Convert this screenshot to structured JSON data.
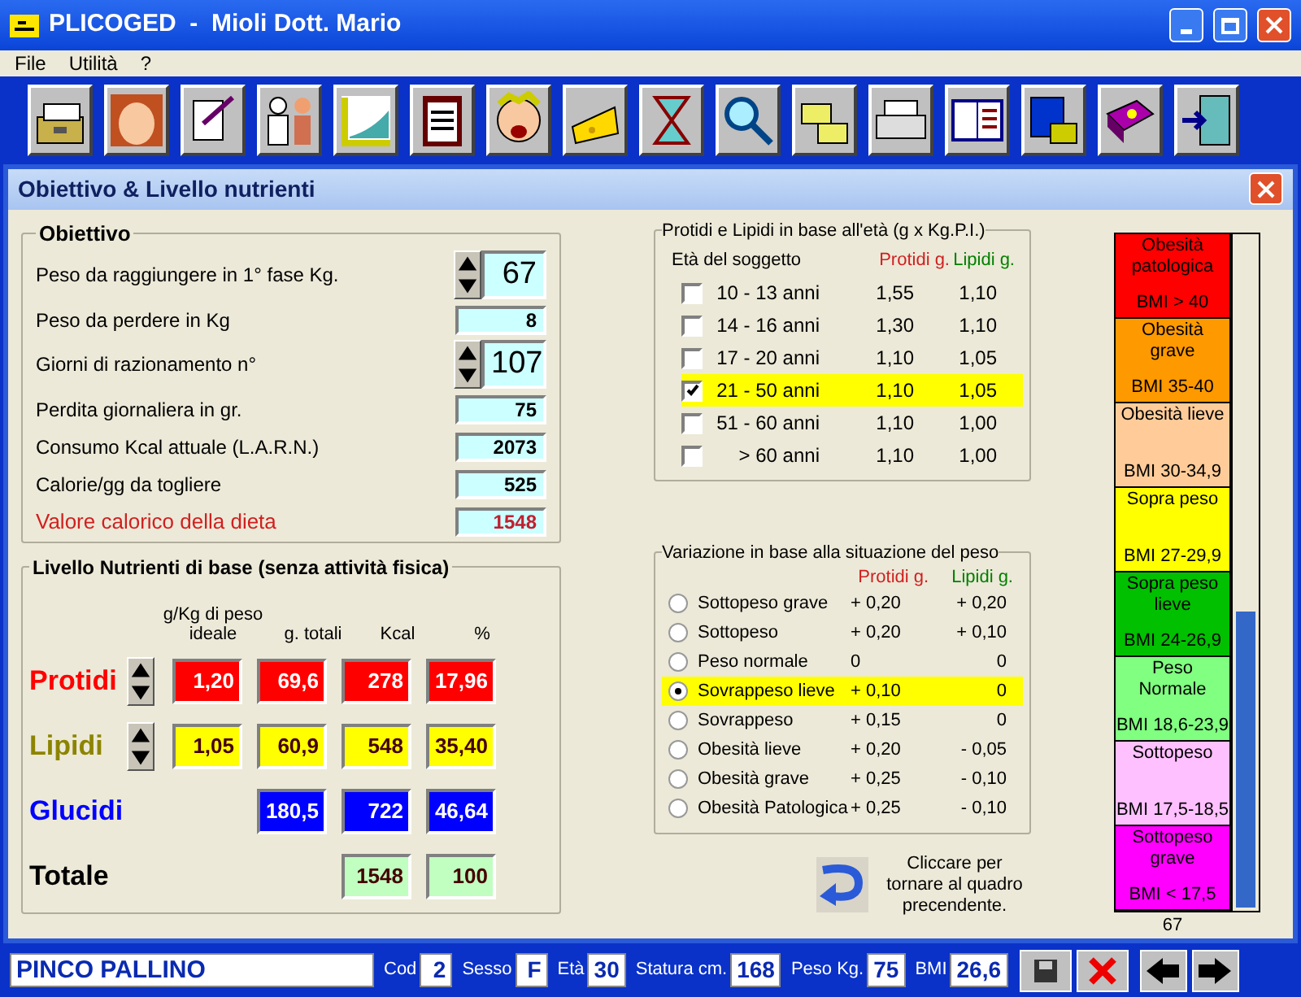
{
  "window": {
    "title": "PLICOGED  -  Mioli Dott. Mario"
  },
  "menu": [
    "File",
    "Utilità",
    "?"
  ],
  "dialog": {
    "title": "Obiettivo & Livello nutrienti"
  },
  "objective": {
    "title": "Obiettivo",
    "rows": [
      {
        "kind": "spin",
        "label": "Peso da raggiungere in 1° fase Kg.",
        "value": "67"
      },
      {
        "kind": "field",
        "label": "Peso da perdere in Kg",
        "value": "8"
      },
      {
        "kind": "spin",
        "label": "Giorni di razionamento n°",
        "value": "107"
      },
      {
        "kind": "field",
        "label": "Perdita giornaliera in gr.",
        "value": "75"
      },
      {
        "kind": "field",
        "label": "Consumo Kcal attuale (L.A.R.N.)",
        "value": "2073"
      },
      {
        "kind": "field",
        "label": "Calorie/gg da togliere",
        "value": "525"
      },
      {
        "kind": "total",
        "label": "Valore calorico della dieta",
        "value": "1548"
      }
    ]
  },
  "nutrients": {
    "title": "Livello Nutrienti di base (senza attività fisica)",
    "columns": [
      "g/Kg di peso ideale",
      "g. totali",
      "Kcal",
      "%"
    ],
    "rows": [
      {
        "label": "Protidi",
        "color": "#ff0000",
        "spin": true,
        "cells": [
          "1,20",
          "69,6",
          "278",
          "17,96"
        ]
      },
      {
        "label": "Lipidi",
        "color": "#ffff00",
        "spin": true,
        "cells": [
          "1,05",
          "60,9",
          "548",
          "35,40"
        ]
      },
      {
        "label": "Glucidi",
        "color": "#0000ff",
        "spin": false,
        "cells": [
          "",
          "180,5",
          "722",
          "46,64"
        ]
      },
      {
        "label": "Totale",
        "color": "#c0ffc0",
        "spin": false,
        "cells": [
          "",
          "",
          "1548",
          "100"
        ]
      }
    ]
  },
  "age": {
    "title": "Protidi e Lipidi  in base all'età (g x Kg.P.I.)",
    "columns": [
      "Età del soggetto",
      "Protidi g.",
      "Lipidi g."
    ],
    "rows": [
      {
        "label": "10 - 13 anni",
        "protidi": "1,55",
        "lipidi": "1,10",
        "checked": false
      },
      {
        "label": "14 - 16 anni",
        "protidi": "1,30",
        "lipidi": "1,10",
        "checked": false
      },
      {
        "label": "17 - 20 anni",
        "protidi": "1,10",
        "lipidi": "1,05",
        "checked": false
      },
      {
        "label": "21 - 50 anni",
        "protidi": "1,10",
        "lipidi": "1,05",
        "checked": true
      },
      {
        "label": "51 - 60 anni",
        "protidi": "1,10",
        "lipidi": "1,00",
        "checked": false
      },
      {
        "label": "> 60 anni",
        "protidi": "1,10",
        "lipidi": "1,00",
        "checked": false
      }
    ]
  },
  "variation": {
    "title": "Variazione in base alla situazione del peso",
    "columns": [
      "Protidi g.",
      "Lipidi g."
    ],
    "rows": [
      {
        "label": "Sottopeso grave",
        "protidi": "+ 0,20",
        "lipidi": "+ 0,20",
        "selected": false
      },
      {
        "label": "Sottopeso",
        "protidi": "+ 0,20",
        "lipidi": "+ 0,10",
        "selected": false
      },
      {
        "label": "Peso normale",
        "protidi": "0",
        "lipidi": "0",
        "selected": false
      },
      {
        "label": "Sovrappeso lieve",
        "protidi": "+ 0,10",
        "lipidi": "0",
        "selected": true
      },
      {
        "label": "Sovrappeso",
        "protidi": "+ 0,15",
        "lipidi": "0",
        "selected": false
      },
      {
        "label": "Obesità lieve",
        "protidi": "+ 0,20",
        "lipidi": "- 0,05",
        "selected": false
      },
      {
        "label": "Obesità grave",
        "protidi": "+ 0,25",
        "lipidi": "- 0,10",
        "selected": false
      },
      {
        "label": "Obesità Patologica",
        "protidi": "+ 0,25",
        "lipidi": "- 0,10",
        "selected": false
      }
    ]
  },
  "back_hint": "Cliccare per tornare al quadro precendente.",
  "bmi": {
    "bands": [
      {
        "name": "Obesità patologica",
        "range": "BMI > 40",
        "color": "#ff0000"
      },
      {
        "name": "Obesità grave",
        "range": "BMI 35-40",
        "color": "#ff9900"
      },
      {
        "name": "Obesità lieve",
        "range": "BMI 30-34,9",
        "color": "#ffcc99"
      },
      {
        "name": "Sopra peso",
        "range": "BMI 27-29,9",
        "color": "#ffff00"
      },
      {
        "name": "Sopra peso lieve",
        "range": "BMI 24-26,9",
        "color": "#00c000"
      },
      {
        "name": "Peso Normale",
        "range": "BMI 18,6-23,9",
        "color": "#80ff80"
      },
      {
        "name": "Sottopeso",
        "range": "BMI 17,5-18,5",
        "color": "#ffc0ff"
      },
      {
        "name": "Sottopeso grave",
        "range": "BMI < 17,5",
        "color": "#ff00ff"
      }
    ],
    "level": 0.44,
    "reading": "67"
  },
  "status": {
    "name": "PINCO PALLINO",
    "fields": [
      {
        "label": "Cod",
        "value": "2"
      },
      {
        "label": "Sesso",
        "value": "F"
      },
      {
        "label": "Età",
        "value": "30"
      },
      {
        "label": "Statura cm.",
        "value": "168"
      },
      {
        "label": "Peso Kg.",
        "value": "75"
      },
      {
        "label": "BMI",
        "value": "26,6"
      }
    ]
  }
}
